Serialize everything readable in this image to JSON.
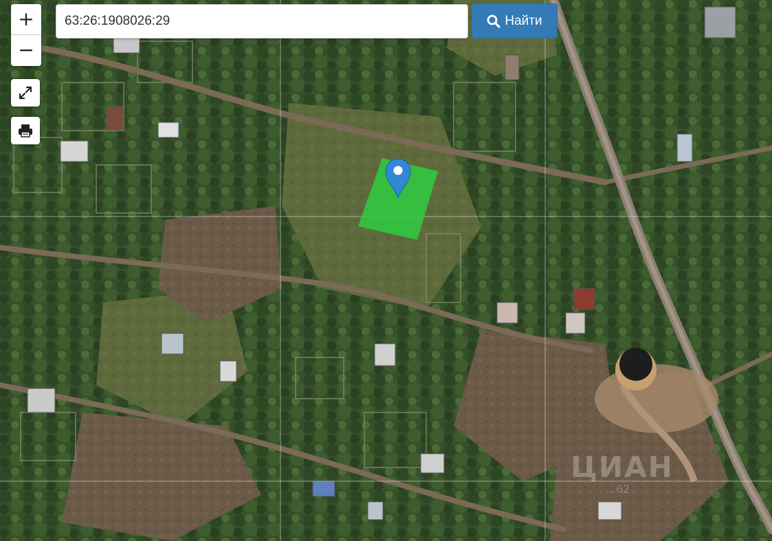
{
  "search": {
    "value": "63:26:1908026:29",
    "button_label": "Найти",
    "button_color": "#337ab7"
  },
  "controls": {
    "zoom_in": "+",
    "zoom_out": "−",
    "fullscreen_icon": "expand-icon",
    "print_icon": "printer-icon"
  },
  "parcel": {
    "fill_color": "#2ecc40",
    "marker_color": "#3388d6",
    "marker_icon": "map-marker-icon"
  },
  "watermark": {
    "text": "ЦИАН",
    "sub": "…62"
  }
}
